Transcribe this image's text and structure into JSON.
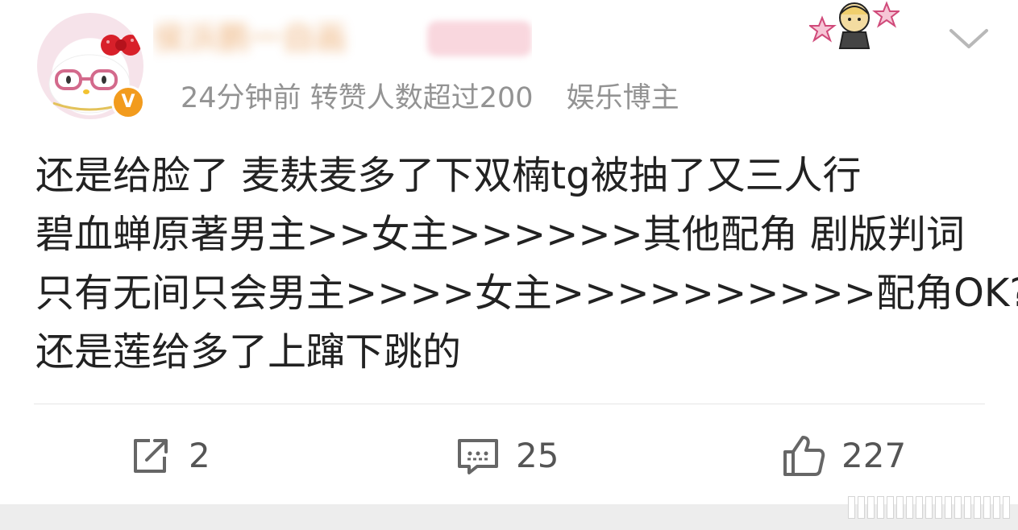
{
  "post": {
    "username": "侯浜鹏一自画",
    "meta": {
      "time": "24分钟前",
      "repost_note": "转赞人数超过200",
      "role": "娱乐博主"
    },
    "lines": [
      "还是给脸了 麦麸麦多了下双楠tg被抽了又三人行",
      "碧血蝉原著男主>>女主>>>>>>其他配角 剧版判词",
      "只有无间只会男主>>>>女主>>>>>>>>>>配角OK?",
      "还是莲给多了上蹿下跳的"
    ],
    "verified_badge": "V"
  },
  "actions": {
    "repost_count": "2",
    "comment_count": "25",
    "like_count": "227"
  },
  "icons": {
    "repost": "share-edit-icon",
    "comment": "comment-bubble-icon",
    "like": "thumbs-up-icon",
    "menu": "chevron-down-icon"
  },
  "colors": {
    "verified": "#f29b1d",
    "meta_text": "#939393",
    "body_text": "#222222"
  }
}
